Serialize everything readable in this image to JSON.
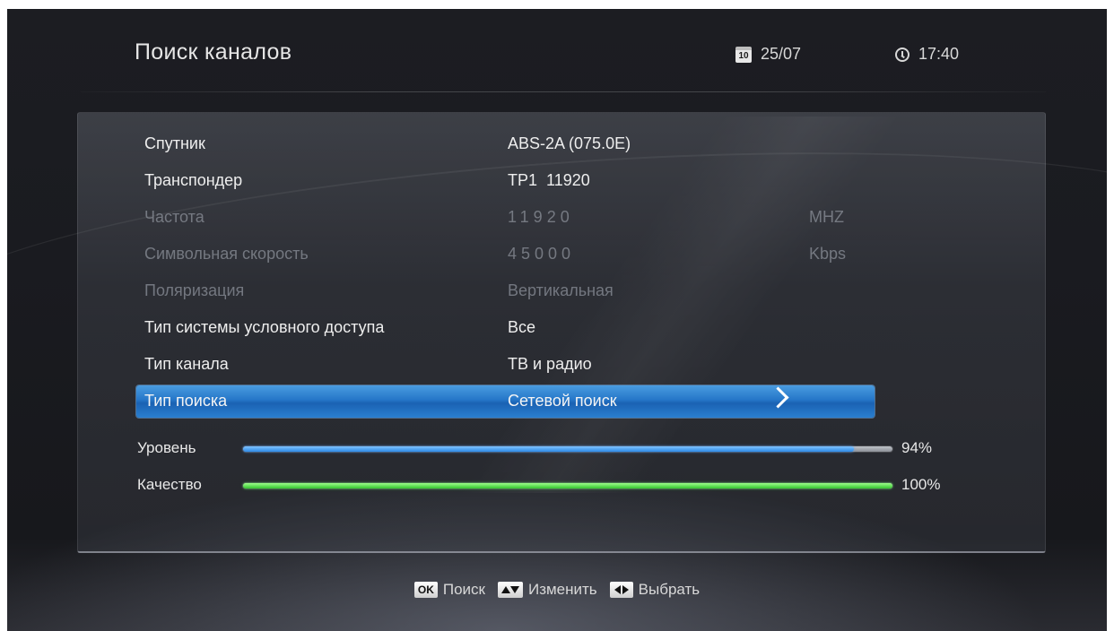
{
  "header": {
    "title": "Поиск каналов",
    "date": "25/07",
    "time": "17:40",
    "date_icon": "calendar-icon",
    "time_icon": "clock-icon"
  },
  "settings": {
    "rows": [
      {
        "label": "Спутник",
        "value": "ABS-2A (075.0E)",
        "unit": "",
        "enabled": true
      },
      {
        "label": "Транспондер",
        "value": "TP1  11920",
        "unit": "",
        "enabled": true
      },
      {
        "label": "Частота",
        "value": "11920",
        "unit": "MHZ",
        "enabled": false
      },
      {
        "label": "Символьная скорость",
        "value": "45000",
        "unit": "Kbps",
        "enabled": false
      },
      {
        "label": "Поляризация",
        "value": "Вертикальная",
        "unit": "",
        "enabled": false
      },
      {
        "label": "Тип системы условного доступа",
        "value": "Все",
        "unit": "",
        "enabled": true
      },
      {
        "label": "Тип канала",
        "value": "ТВ и радио",
        "unit": "",
        "enabled": true
      },
      {
        "label": "Тип поиска",
        "value": "Сетевой поиск",
        "unit": "",
        "enabled": true,
        "selected": true
      }
    ]
  },
  "signal": {
    "level_label": "Уровень",
    "level_value": 94,
    "level_text": "94%",
    "quality_label": "Качество",
    "quality_value": 100,
    "quality_text": "100%",
    "colors": {
      "level": "#2d8ae6",
      "quality": "#34c42e"
    }
  },
  "footer": {
    "ok_key": "OK",
    "ok_label": "Поиск",
    "updown_label": "Изменить",
    "leftright_label": "Выбрать"
  },
  "colors": {
    "selection": "#2576c8",
    "background": "#1a1b20"
  }
}
